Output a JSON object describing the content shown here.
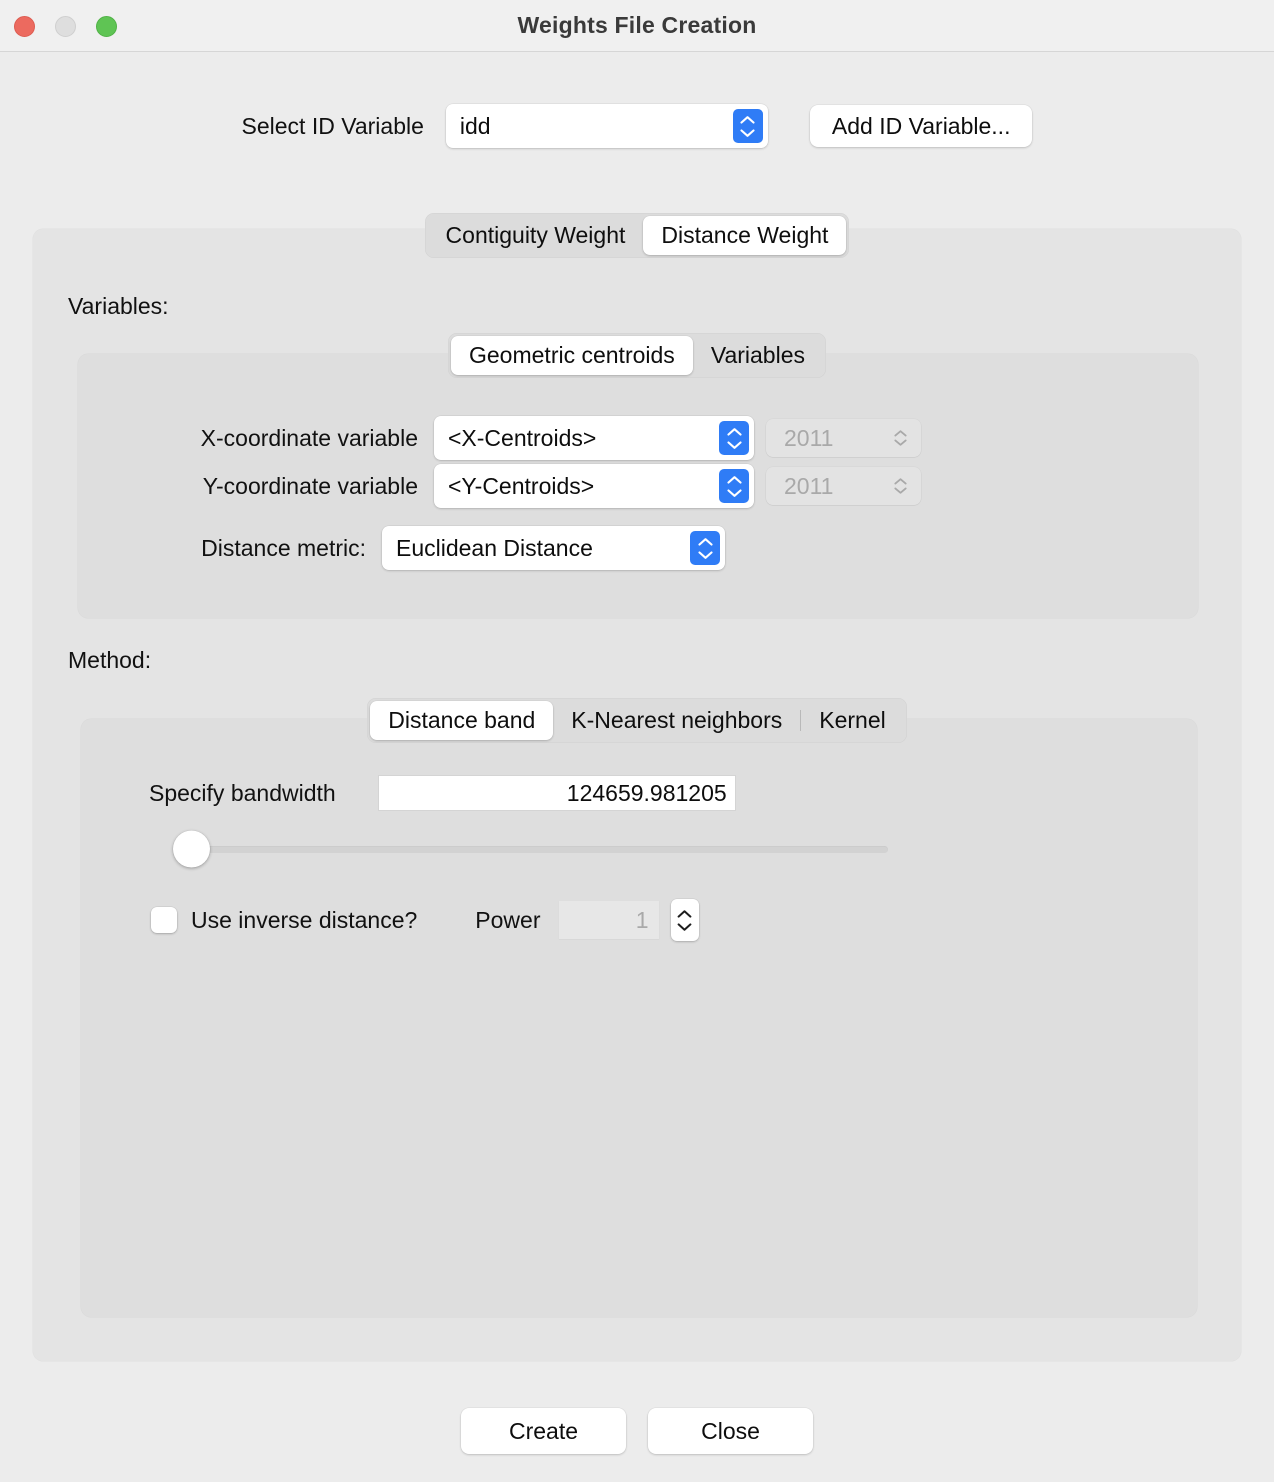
{
  "window": {
    "title": "Weights File Creation",
    "traffic_lights": [
      "close-red",
      "minimize-yellow",
      "zoom-green"
    ]
  },
  "id_row": {
    "label": "Select ID Variable",
    "selected_value": "idd",
    "add_button": "Add ID Variable..."
  },
  "weight_tabs": {
    "items": [
      {
        "label": "Contiguity Weight",
        "active": false
      },
      {
        "label": "Distance Weight",
        "active": true
      }
    ]
  },
  "variables": {
    "section_label": "Variables:",
    "source_tabs": [
      {
        "label": "Geometric centroids",
        "active": true
      },
      {
        "label": "Variables",
        "active": false
      }
    ],
    "rows": [
      {
        "label": "X-coordinate variable",
        "value": "<X-Centroids>",
        "time_value": "2011",
        "time_disabled": true
      },
      {
        "label": "Y-coordinate variable",
        "value": "<Y-Centroids>",
        "time_value": "2011",
        "time_disabled": true
      }
    ],
    "metric_label": "Distance metric:",
    "metric_value": "Euclidean Distance"
  },
  "method": {
    "section_label": "Method:",
    "tabs": [
      {
        "label": "Distance band",
        "active": true
      },
      {
        "label": "K-Nearest neighbors",
        "active": false
      },
      {
        "label": "Kernel",
        "active": false
      }
    ],
    "bandwidth_label": "Specify bandwidth",
    "bandwidth_value": "124659.981205",
    "slider_position_percent": 2,
    "inverse_distance_label": "Use inverse distance?",
    "inverse_distance_checked": false,
    "power_label": "Power",
    "power_value": "1",
    "power_disabled": true
  },
  "footer": {
    "create_label": "Create",
    "close_label": "Close"
  },
  "colors": {
    "accent_blue": "#2f7cf6",
    "window_bg": "#ececec",
    "panel_bg": "#e4e4e4",
    "inner_bg": "#dedede",
    "titlebar_bg": "#f0f0f0",
    "traffic_red": "#ec6a5f",
    "traffic_yellow": "#dedede",
    "traffic_green": "#5fc454"
  }
}
